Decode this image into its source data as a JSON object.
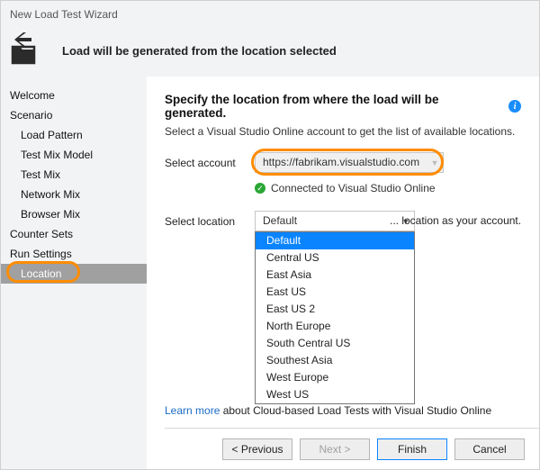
{
  "window": {
    "title": "New Load Test Wizard"
  },
  "header": {
    "title": "Load will be generated from the location selected"
  },
  "sidebar": {
    "items": [
      {
        "label": "Welcome",
        "sub": false
      },
      {
        "label": "Scenario",
        "sub": false
      },
      {
        "label": "Load Pattern",
        "sub": true
      },
      {
        "label": "Test Mix Model",
        "sub": true
      },
      {
        "label": "Test Mix",
        "sub": true
      },
      {
        "label": "Network Mix",
        "sub": true
      },
      {
        "label": "Browser Mix",
        "sub": true
      },
      {
        "label": "Counter Sets",
        "sub": false
      },
      {
        "label": "Run Settings",
        "sub": false
      },
      {
        "label": "Location",
        "sub": true,
        "selected": true
      }
    ]
  },
  "main": {
    "heading": "Specify the location from where the load will be generated.",
    "subheading": "Select a Visual Studio Online account to get the list of available locations.",
    "account_label": "Select account",
    "account_value": "https://fabrikam.visualstudio.com",
    "connected_text": "Connected to Visual Studio Online",
    "location_label": "Select location",
    "location_value": "Default",
    "location_hint": "... location as your account.",
    "location_options": [
      "Default",
      "Central US",
      "East Asia",
      "East US",
      "East US 2",
      "North Europe",
      "South Central US",
      "Southest Asia",
      "West Europe",
      "West US"
    ],
    "learn_more_link": "Learn more",
    "learn_more_rest": " about Cloud-based Load Tests with Visual Studio Online"
  },
  "buttons": {
    "previous": "< Previous",
    "next": "Next >",
    "finish": "Finish",
    "cancel": "Cancel"
  }
}
